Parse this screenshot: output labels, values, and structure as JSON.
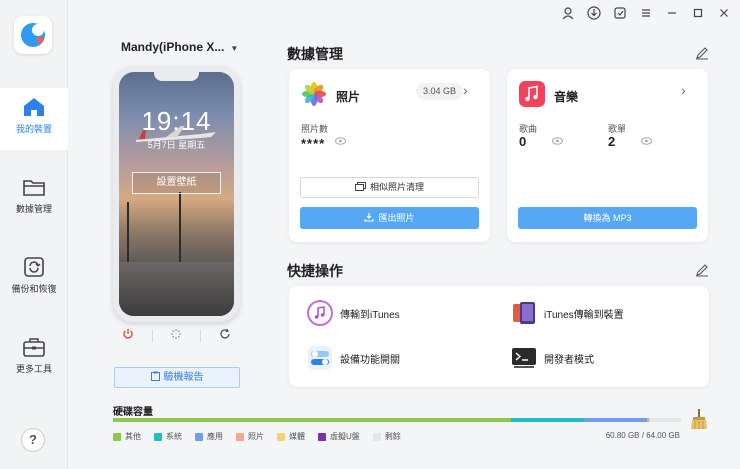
{
  "sidebar": {
    "items": [
      {
        "label": "我的裝置",
        "icon": "home-icon",
        "active": true
      },
      {
        "label": "數據管理",
        "icon": "folder-icon",
        "active": false
      },
      {
        "label": "備份和恢復",
        "icon": "backup-restore-icon",
        "active": false
      },
      {
        "label": "更多工具",
        "icon": "toolbox-icon",
        "active": false
      }
    ],
    "help_label": "?"
  },
  "device": {
    "name": "Mandy(iPhone X...",
    "lock_time": "19:14",
    "lock_date": "5月7日 星期五",
    "wallpaper_button": "設置壁紙",
    "report_button": "驗機報告"
  },
  "data_management": {
    "title": "數據管理",
    "photos": {
      "title": "照片",
      "size": "3.04 GB",
      "count_label": "照片數",
      "count_value": "****",
      "similar_button": "相似照片清理",
      "export_button": "匯出照片"
    },
    "music": {
      "title": "音樂",
      "songs_label": "歌曲",
      "songs_value": "0",
      "playlists_label": "歌單",
      "playlists_value": "2",
      "convert_button": "轉換為 MP3"
    }
  },
  "quick_actions": {
    "title": "快捷操作",
    "items": [
      {
        "label": "傳輸到iTunes"
      },
      {
        "label": "iTunes傳輸到裝置"
      },
      {
        "label": "設備功能開關"
      },
      {
        "label": "開發者模式"
      }
    ]
  },
  "storage": {
    "title": "硬碟容量",
    "used_text": "60.80 GB / 64.00 GB",
    "segments": [
      {
        "label": "其他",
        "color": "#8cc84b",
        "fraction": 0.7
      },
      {
        "label": "系統",
        "color": "#1fbdbd",
        "fraction": 0.13
      },
      {
        "label": "應用",
        "color": "#6e9ff0",
        "fraction": 0.11
      },
      {
        "label": "照片",
        "color": "#f0a890",
        "fraction": 0.004
      },
      {
        "label": "媒體",
        "color": "#f5d27a",
        "fraction": 0.002
      },
      {
        "label": "虛擬U盤",
        "color": "#7b2fb3",
        "fraction": 0.0
      },
      {
        "label": "剩餘",
        "color": "#e5e6e8",
        "fraction": 0.05
      }
    ]
  },
  "colors": {
    "accent": "#2f80ed",
    "primary_button": "#57a8f4"
  }
}
